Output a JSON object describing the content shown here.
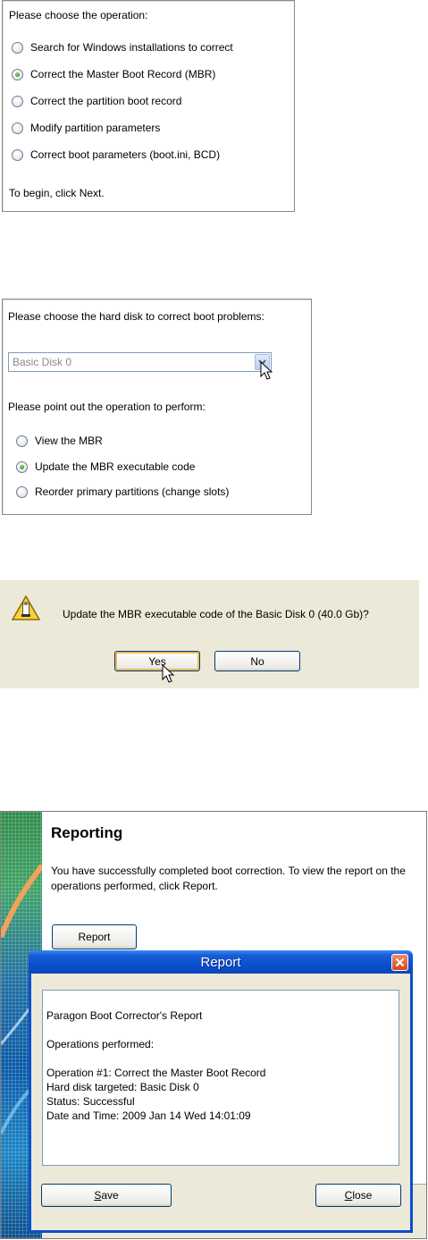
{
  "panel1": {
    "heading": "Please choose the operation:",
    "options": [
      {
        "label": "Search for Windows installations to correct",
        "checked": false
      },
      {
        "label": "Correct the Master Boot Record (MBR)",
        "checked": true
      },
      {
        "label": "Correct the partition boot record",
        "checked": false
      },
      {
        "label": "Modify partition parameters",
        "checked": false
      },
      {
        "label": "Correct boot parameters (boot.ini, BCD)",
        "checked": false
      }
    ],
    "footer": "To begin, click Next."
  },
  "panel2": {
    "heading": "Please choose the hard disk to correct boot problems:",
    "select_value": "Basic Disk 0",
    "subheading": "Please point out the operation to perform:",
    "options": [
      {
        "label": "View the MBR",
        "checked": false
      },
      {
        "label": "Update the MBR executable code",
        "checked": true
      },
      {
        "label": "Reorder primary partitions (change slots)",
        "checked": false
      }
    ]
  },
  "confirm": {
    "message": "Update the MBR executable code of the Basic Disk 0 (40.0 Gb)?",
    "yes_label": "Yes",
    "no_label": "No"
  },
  "reporting": {
    "title": "Reporting",
    "description": "You have successfully completed boot correction. To view the report on the operations performed, click Report.",
    "report_button": "Report"
  },
  "report_dialog": {
    "title": "Report",
    "lines": [
      "Paragon Boot Corrector's Report",
      "",
      "Operations performed:",
      "",
      "Operation #1: Correct the Master Boot Record",
      "Hard disk targeted: Basic Disk 0",
      "Status: Successful",
      "Date and Time: 2009 Jan 14 Wed 14:01:09"
    ],
    "save_first": "S",
    "save_rest": "ave",
    "close_first": "C",
    "close_rest": "lose"
  },
  "colors": {
    "xp_blue": "#0b4fd0",
    "close_red": "#e0522a",
    "dialog_bg": "#ece9d8",
    "wizard_green": "#2e8b4a"
  }
}
